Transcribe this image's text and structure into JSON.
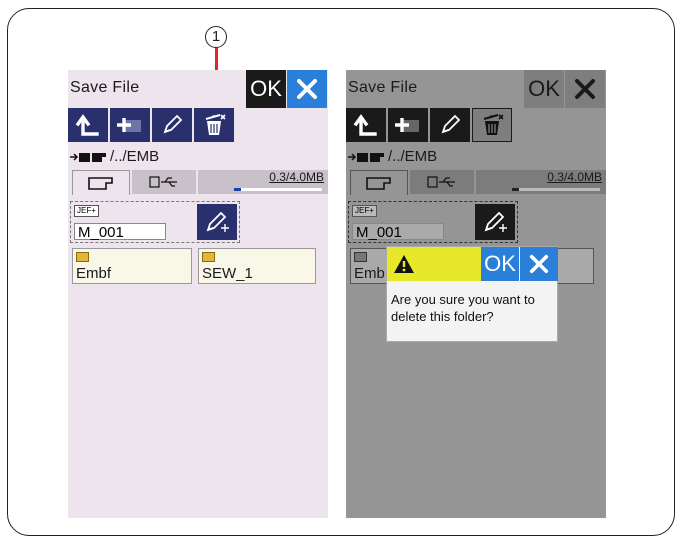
{
  "callout": {
    "number": "1"
  },
  "left_screen": {
    "title": "Save File",
    "ok_label": "OK",
    "path": "/../EMB",
    "memory": "0.3/4.0MB",
    "memory_used_fraction": 0.075,
    "file": {
      "badge": "JEF+",
      "name": "M_001"
    },
    "folders": [
      "Embf",
      "SEW_1"
    ],
    "toolbar_icons": [
      "up-arrow-icon",
      "new-folder-icon",
      "rename-pencil-icon",
      "delete-trash-icon"
    ]
  },
  "right_screen": {
    "title": "Save File",
    "ok_label": "OK",
    "path": "/../EMB",
    "memory": "0.3/4.0MB",
    "memory_used_fraction": 0.075,
    "file": {
      "badge": "JEF+",
      "name": "M_001"
    },
    "folders": [
      "Emb"
    ],
    "dialog": {
      "ok_label": "OK",
      "message": "Are you sure you want to delete this folder?"
    }
  },
  "colors": {
    "button_navy": "#2a2f6e",
    "ok_blue": "#2a7fd8",
    "screen_bg": "#ede4ed",
    "dim_bg": "#959595",
    "warning_yellow": "#e8e82a",
    "callout_red": "#e2262b"
  }
}
